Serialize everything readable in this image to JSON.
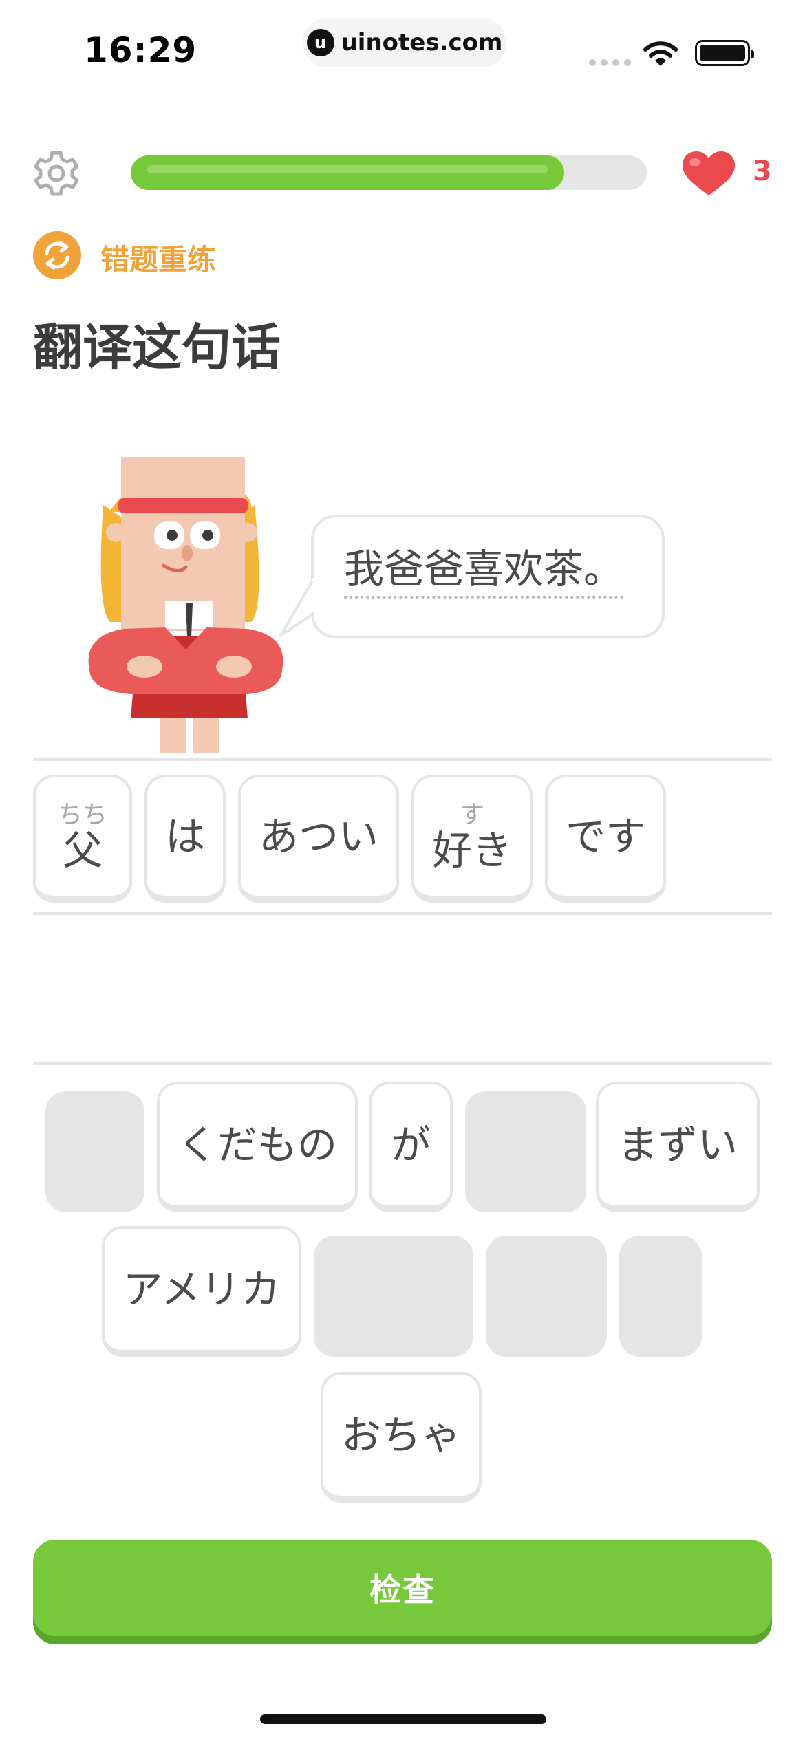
{
  "status_bar": {
    "time": "16:29",
    "url": "uinotes.com",
    "url_logo": "u"
  },
  "header": {
    "hearts_count": "3",
    "progress_fraction": 0.84
  },
  "lesson": {
    "review_label": "错题重练",
    "instruction": "翻译这句话"
  },
  "prompt": {
    "sentence": "我爸爸喜欢茶。"
  },
  "answer_tiles": [
    {
      "furigana": "ちち",
      "text": "父"
    },
    {
      "text": "は"
    },
    {
      "text": "あつい"
    },
    {
      "furigana": "す",
      "text": "好き"
    },
    {
      "text": "です"
    }
  ],
  "word_bank": [
    {
      "text": "くだもの"
    },
    {
      "text": "が"
    },
    {
      "text": "まずい"
    },
    {
      "text": "アメリカ"
    },
    {
      "text": "おちゃ"
    }
  ],
  "actions": {
    "check_label": "检查"
  },
  "colors": {
    "green": "#78c83c",
    "orange": "#f0a33a",
    "red": "#ea4a4e",
    "gray": "#e5e5e5"
  }
}
